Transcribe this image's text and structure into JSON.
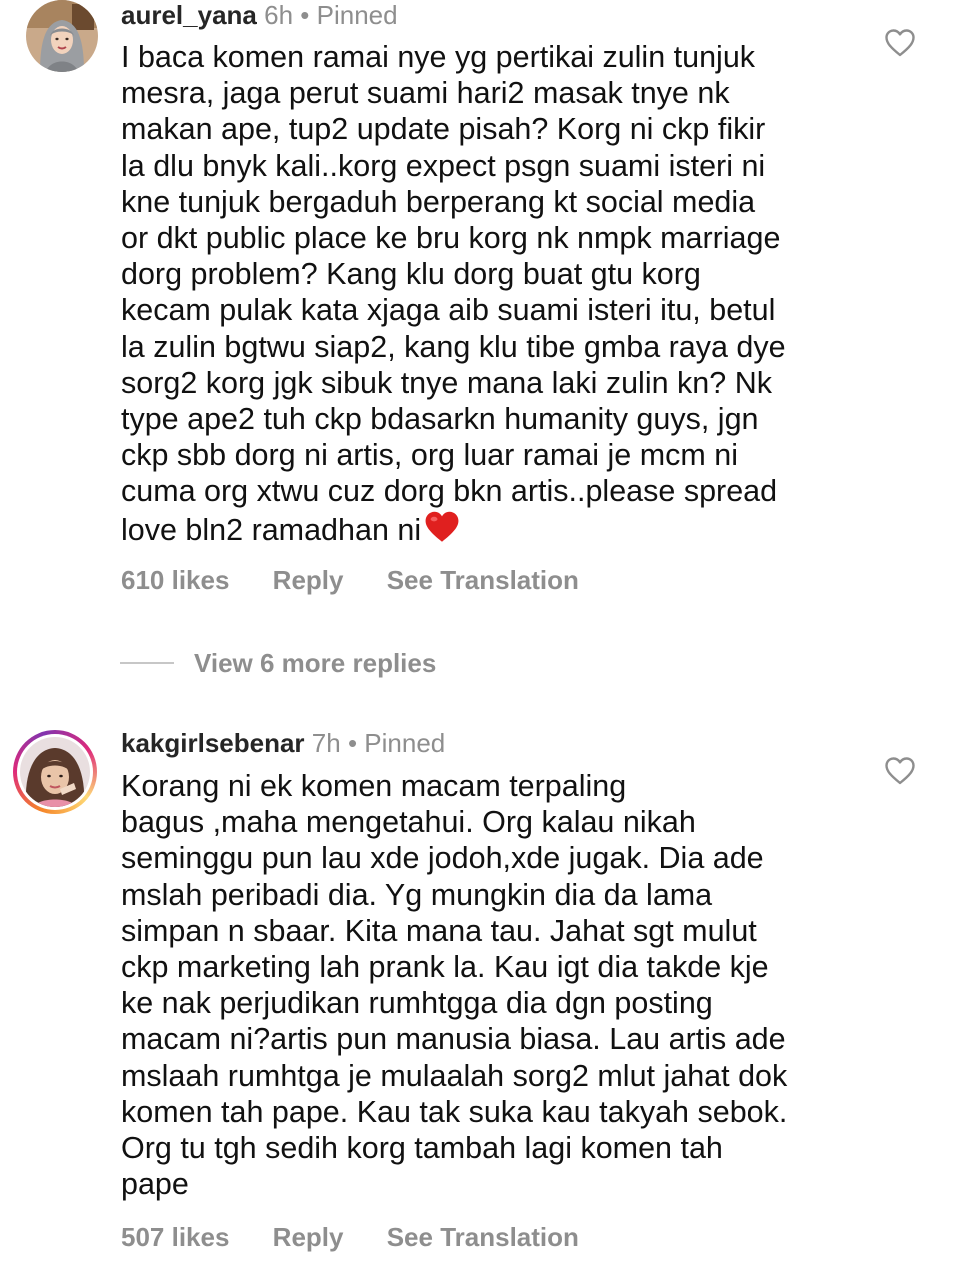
{
  "comments": [
    {
      "username": "aurel_yana",
      "time": "6h",
      "separator": "•",
      "pinned_label": "Pinned",
      "avatar_icon": "avatar-hijab-woman",
      "text": "I baca komen ramai nye yg pertikai zulin tunjuk\nmesra, jaga perut suami hari2 masak tnye nk\nmakan ape, tup2 update pisah? Korg ni ckp fikir\nla dlu bnyk kali..korg expect psgn suami isteri ni\nkne tunjuk bergaduh berperang kt social media\nor dkt public place ke bru korg nk nmpk marriage\ndorg problem? Kang klu dorg buat gtu korg\nkecam pulak kata xjaga aib suami isteri itu, betul\nla zulin bgtwu siap2, kang klu tibe gmba raya dye\nsorg2 korg jgk sibuk tnye mana laki zulin kn? Nk\ntype ape2 tuh ckp bdasarkn humanity guys, jgn\nckp sbb dorg ni artis, org luar ramai je mcm ni\ncuma org xtwu cuz dorg bkn artis..please spread\nlove bln2 ramadhan ni",
      "emoji": "❤️",
      "likes": "610 likes",
      "reply_label": "Reply",
      "translate_label": "See Translation",
      "like_icon": "heart-outline-icon"
    },
    {
      "username": "kakgirlsebenar",
      "time": "7h",
      "separator": "•",
      "pinned_label": "Pinned",
      "avatar_icon": "avatar-story-ring",
      "text": "Korang ni ek komen macam terpaling\nbagus ,maha mengetahui. Org kalau nikah\nseminggu pun lau xde jodoh,xde jugak. Dia ade\nmslah peribadi dia. Yg mungkin dia da lama\nsimpan n sbaar. Kita mana tau. Jahat sgt mulut\nckp marketing lah prank la. Kau igt dia takde kje\nke nak perjudikan rumhtgga dia dgn posting\nmacam ni?artis pun manusia biasa. Lau artis ade\nmslaah rumhtga je mulaalah sorg2 mlut jahat dok\nkomen tah pape. Kau tak suka kau takyah sebok.\nOrg tu tgh sedih korg tambah lagi komen tah\npape",
      "likes": "507 likes",
      "reply_label": "Reply",
      "translate_label": "See Translation",
      "like_icon": "heart-outline-icon"
    }
  ],
  "view_more": {
    "label": "View 6 more replies"
  },
  "colors": {
    "text": "#111111",
    "muted": "#8e8e8e",
    "username": "#262626",
    "divider": "#c7c7c7",
    "heart_emoji": "#e0201f"
  }
}
